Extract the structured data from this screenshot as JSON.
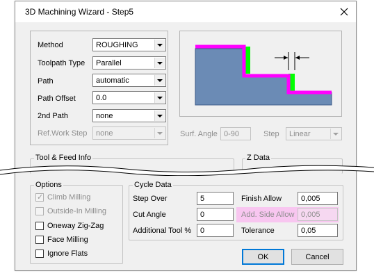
{
  "window": {
    "title": "3D Machining Wizard - Step5",
    "close_icon": "close-icon"
  },
  "method": {
    "label": "Method",
    "value": "ROUGHING"
  },
  "toolpath_type": {
    "label": "Toolpath Type",
    "value": "Parallel"
  },
  "path": {
    "label": "Path",
    "value": "automatic"
  },
  "path_offset": {
    "label": "Path Offset",
    "value": "0.0"
  },
  "second_path": {
    "label": "2nd Path",
    "value": "none"
  },
  "ref_work_step": {
    "label": "Ref.Work Step",
    "value": "none"
  },
  "surf_angle": {
    "label": "Surf. Angle",
    "value": "0-90"
  },
  "step": {
    "label": "Step",
    "value": "Linear"
  },
  "tool_feed_info": {
    "title": "Tool & Feed Info"
  },
  "z_data": {
    "title": "Z Data"
  },
  "options": {
    "title": "Options",
    "items": [
      {
        "label": "Climb Milling",
        "checked": true,
        "disabled": true
      },
      {
        "label": "Outside-In Milling",
        "checked": false,
        "disabled": true
      },
      {
        "label": "Oneway Zig-Zag",
        "checked": false,
        "disabled": false
      },
      {
        "label": "Face Milling",
        "checked": false,
        "disabled": false
      },
      {
        "label": "Ignore Flats",
        "checked": false,
        "disabled": false
      }
    ]
  },
  "cycle_data": {
    "title": "Cycle Data",
    "step_over": {
      "label": "Step Over",
      "value": "5"
    },
    "cut_angle": {
      "label": "Cut Angle",
      "value": "0"
    },
    "additional_tool": {
      "label": "Additional Tool %",
      "value": "0"
    },
    "finish_allow": {
      "label": "Finish Allow",
      "value": "0,005"
    },
    "add_side_allow": {
      "label": "Add. Side Allow",
      "value": "0,005"
    },
    "tolerance": {
      "label": "Tolerance",
      "value": "0,05"
    }
  },
  "buttons": {
    "ok": "OK",
    "cancel": "Cancel"
  },
  "colors": {
    "part_blue": "#6b8bb5",
    "toolpath_magenta": "#ff00ff",
    "allowance_green": "#00ff00",
    "highlight_pink": "#f8c6f0",
    "focus_blue": "#0078d7"
  }
}
